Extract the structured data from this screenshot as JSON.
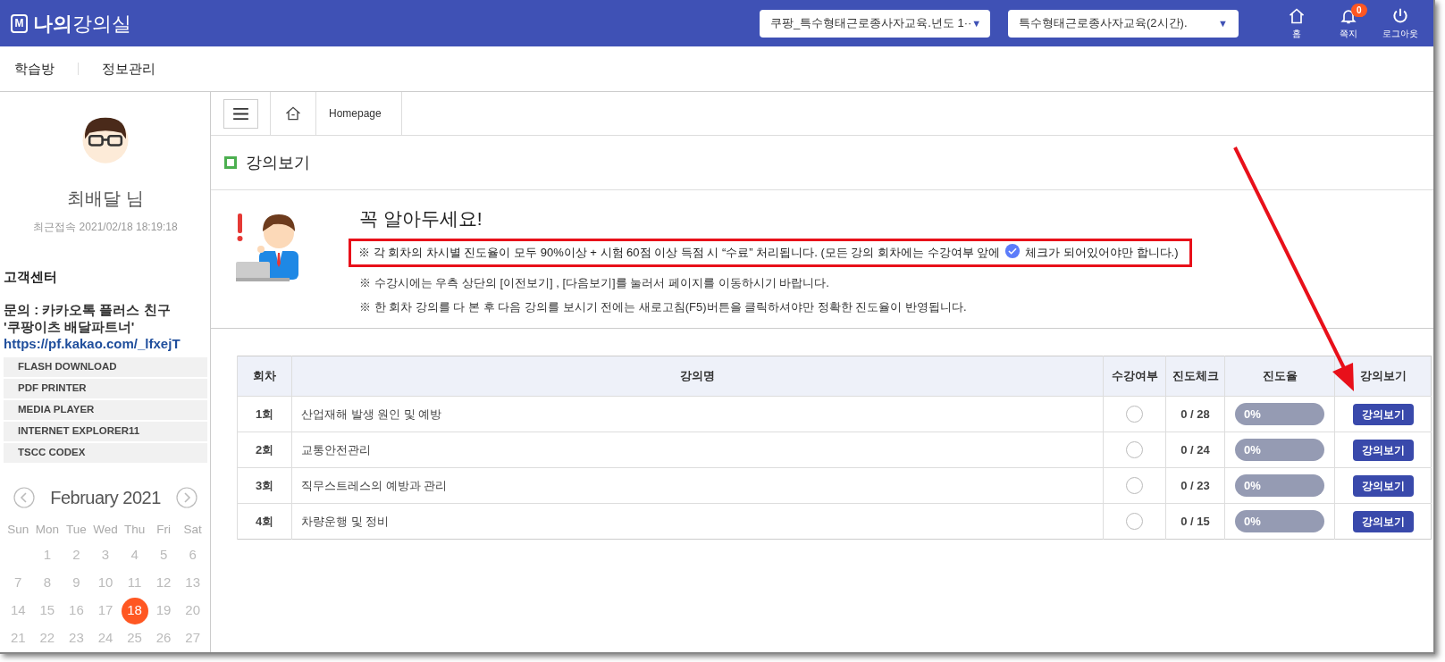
{
  "header": {
    "logo_letter": "M",
    "title_bold": "나의",
    "title": "강의실",
    "selects": [
      "쿠팡_특수형태근로종사자교육.년도 1··",
      "특수형태근로종사자교육(2시간)."
    ],
    "select_arrow": "▼",
    "icons": [
      {
        "kind": "home",
        "label": "홈"
      },
      {
        "kind": "bell",
        "label": "쪽지",
        "badge": "0"
      },
      {
        "kind": "power",
        "label": "로그아웃"
      }
    ]
  },
  "nav": [
    "학습방",
    "정보관리"
  ],
  "sidebar": {
    "user_name": "최배달 님",
    "last_access": "최근접속 2021/02/18 18:19:18",
    "support_title": "고객센터",
    "contact_lines": [
      "문의 : 카카오톡 플러스 친구",
      "'쿠팡이츠 배달파트너'"
    ],
    "contact_link": "https://pf.kakao.com/_lfxejT",
    "downloads": [
      "FLASH DOWNLOAD",
      "PDF PRINTER",
      "MEDIA PLAYER",
      "INTERNET EXPLORER11",
      "TSCC CODEX"
    ],
    "calendar": {
      "month": "February 2021",
      "weekdays": [
        "Sun",
        "Mon",
        "Tue",
        "Wed",
        "Thu",
        "Fri",
        "Sat"
      ],
      "weeks": [
        [
          {
            "day": "1",
            "selected": false
          },
          {
            "day": "2",
            "selected": false
          },
          {
            "day": "3",
            "selected": false
          },
          {
            "day": "4",
            "selected": false
          },
          {
            "day": "5",
            "selected": false
          },
          {
            "day": "6",
            "selected": false
          }
        ],
        [
          {
            "day": "7",
            "selected": false
          },
          {
            "day": "8",
            "selected": false
          },
          {
            "day": "9",
            "selected": false
          },
          {
            "day": "10",
            "selected": false
          },
          {
            "day": "11",
            "selected": false
          },
          {
            "day": "12",
            "selected": false
          },
          {
            "day": "13",
            "selected": false
          }
        ],
        [
          {
            "day": "14",
            "selected": false
          },
          {
            "day": "15",
            "selected": false
          },
          {
            "day": "16",
            "selected": false
          },
          {
            "day": "17",
            "selected": false
          },
          {
            "day": "18",
            "selected": true
          },
          {
            "day": "19",
            "selected": false
          },
          {
            "day": "20",
            "selected": false
          }
        ],
        [
          {
            "day": "21",
            "selected": false
          },
          {
            "day": "22",
            "selected": false
          },
          {
            "day": "23",
            "selected": false
          },
          {
            "day": "24",
            "selected": false
          },
          {
            "day": "25",
            "selected": false
          },
          {
            "day": "26",
            "selected": false
          },
          {
            "day": "27",
            "selected": false
          }
        ]
      ]
    }
  },
  "breadcrumb": "Homepage",
  "page_title": "강의보기",
  "notice": {
    "title": "꼭 알아두세요!",
    "highlight": {
      "before": "※ 각 회차의 차시별 진도율이 모두 90%이상 + 시험 60점 이상 득점 시 “수료” 처리됩니다. (모든 강의 회차에는 수강여부 앞에",
      "after": "체크가 되어있어야만 합니다.)"
    },
    "lines": [
      "※ 수강시에는 우측 상단의 [이전보기] , [다음보기]를 눌러서 페이지를 이동하시기 바랍니다.",
      "※ 한 회차 강의를 다 본 후 다음 강의를 보시기 전에는 새로고침(F5)버튼을 클릭하셔야만 정확한 진도율이 반영됩니다."
    ]
  },
  "table": {
    "columns": [
      "회차",
      "강의명",
      "수강여부",
      "진도체크",
      "진도율",
      "강의보기"
    ],
    "rows": [
      {
        "round": "1회",
        "name": "산업재해 발생 원인 및 예방",
        "checked": false,
        "progress_check": "0 / 28",
        "rate": "0%",
        "level": 0,
        "button": "강의보기"
      },
      {
        "round": "2회",
        "name": "교통안전관리",
        "checked": false,
        "progress_check": "0 / 24",
        "rate": "0%",
        "level": 0,
        "button": "강의보기"
      },
      {
        "round": "3회",
        "name": "직무스트레스의 예방과 관리",
        "checked": false,
        "progress_check": "0 / 23",
        "rate": "0%",
        "level": 0,
        "button": "강의보기"
      },
      {
        "round": "4회",
        "name": "차량운행 및 정비",
        "checked": false,
        "progress_check": "0 / 15",
        "rate": "0%",
        "level": 0,
        "button": "강의보기"
      }
    ]
  }
}
